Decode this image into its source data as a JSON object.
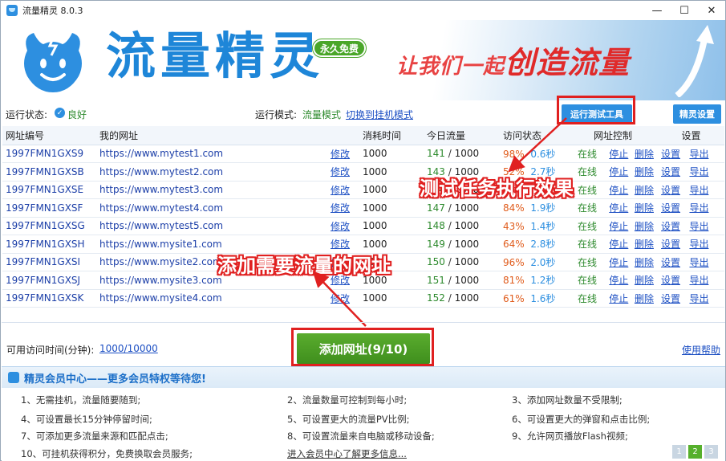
{
  "window": {
    "title": "流量精灵 8.0.3"
  },
  "banner": {
    "brand": "流量精灵",
    "badge": "永久免费",
    "slogan_small": "让我们一起",
    "slogan_big": "创造流量"
  },
  "status": {
    "run_label": "运行状态:",
    "run_value": "良好",
    "mode_label": "运行模式:",
    "mode_value": "流量模式",
    "mode_switch": "切换到挂机模式",
    "test_tool_btn": "运行测试工具",
    "settings_btn": "精灵设置"
  },
  "table": {
    "headers": [
      "网址编号",
      "我的网址",
      "",
      "消耗时间",
      "今日流量",
      "访问状态",
      "网址控制",
      "设置"
    ],
    "edit_label": "修改",
    "online_label": "在线",
    "actions": [
      "停止",
      "删除",
      "设置",
      "导出"
    ],
    "rows": [
      {
        "id": "1997FMN1GXS9",
        "url": "https://www.mytest1.com",
        "time": "1000",
        "today": "141",
        "total": "1000",
        "pct": "98%",
        "sec": "0.6秒"
      },
      {
        "id": "1997FMN1GXSB",
        "url": "https://www.mytest2.com",
        "time": "1000",
        "today": "143",
        "total": "1000",
        "pct": "52%",
        "sec": "2.7秒"
      },
      {
        "id": "1997FMN1GXSE",
        "url": "https://www.mytest3.com",
        "time": "1000",
        "today": "144",
        "total": "1000",
        "pct": "",
        "sec": ""
      },
      {
        "id": "1997FMN1GXSF",
        "url": "https://www.mytest4.com",
        "time": "1000",
        "today": "147",
        "total": "1000",
        "pct": "84%",
        "sec": "1.9秒"
      },
      {
        "id": "1997FMN1GXSG",
        "url": "https://www.mytest5.com",
        "time": "1000",
        "today": "148",
        "total": "1000",
        "pct": "43%",
        "sec": "1.4秒"
      },
      {
        "id": "1997FMN1GXSH",
        "url": "https://www.mysite1.com",
        "time": "1000",
        "today": "149",
        "total": "1000",
        "pct": "64%",
        "sec": "2.8秒"
      },
      {
        "id": "1997FMN1GXSI",
        "url": "https://www.mysite2.com",
        "time": "1000",
        "today": "150",
        "total": "1000",
        "pct": "96%",
        "sec": "2.0秒"
      },
      {
        "id": "1997FMN1GXSJ",
        "url": "https://www.mysite3.com",
        "time": "1000",
        "today": "151",
        "total": "1000",
        "pct": "81%",
        "sec": "1.2秒"
      },
      {
        "id": "1997FMN1GXSK",
        "url": "https://www.mysite4.com",
        "time": "1000",
        "today": "152",
        "total": "1000",
        "pct": "61%",
        "sec": "1.6秒"
      }
    ]
  },
  "annotations": {
    "test_effect": "测试任务执行效果",
    "add_urls": "添加需要流量的网址"
  },
  "bottom": {
    "time_label": "可用访问时间(分钟):",
    "time_value": "1000/10000",
    "add_btn": "添加网址(9/10)",
    "help": "使用帮助"
  },
  "member": {
    "title": "精灵会员中心——更多会员特权等待您!",
    "perks": [
      "1、无需挂机，流量随要随到;",
      "2、流量数量可控制到每小时;",
      "3、添加网址数量不受限制;",
      "4、可设置最长15分钟停留时间;",
      "5、可设置更大的流量PV比例;",
      "6、可设置更大的弹窗和点击比例;",
      "7、可添加更多流量来源和匹配点击;",
      "8、可设置流量来自电脑或移动设备;",
      "9、允许网页播放Flash视频;",
      "10、可挂机获得积分，免费换取会员服务;"
    ],
    "more_link": "进入会员中心了解更多信息...",
    "pages": [
      "1",
      "2",
      "3"
    ]
  },
  "colors": {
    "accent": "#2d8fe0",
    "green": "#4aa629",
    "red": "#e02020",
    "link": "#1c4fc3"
  }
}
